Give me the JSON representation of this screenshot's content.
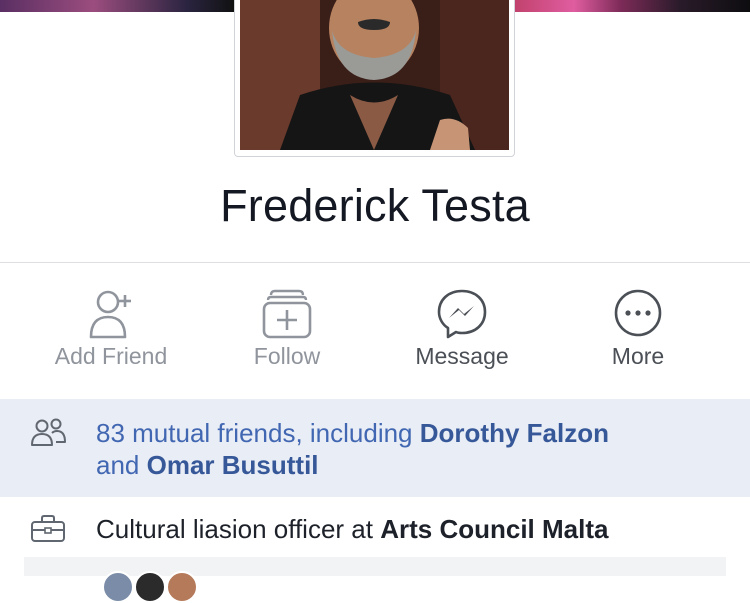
{
  "profile": {
    "name": "Frederick Testa"
  },
  "actions": [
    {
      "label": "Add Friend",
      "icon": "add-friend-icon"
    },
    {
      "label": "Follow",
      "icon": "follow-icon"
    },
    {
      "label": "Message",
      "icon": "messenger-icon"
    },
    {
      "label": "More",
      "icon": "more-icon"
    }
  ],
  "mutual_friends": {
    "prefix": "83 mutual friends, including ",
    "friend_1": "Dorothy Falzon",
    "joiner": "and ",
    "friend_2": "Omar Busuttil",
    "icon": "friends-icon"
  },
  "work": {
    "prefix": "Cultural liasion officer at ",
    "employer": "Arts Council Malta",
    "icon": "briefcase-icon"
  },
  "colors": {
    "link": "#365899",
    "mutual_bg": "#e9edf5",
    "muted": "#90949c"
  }
}
